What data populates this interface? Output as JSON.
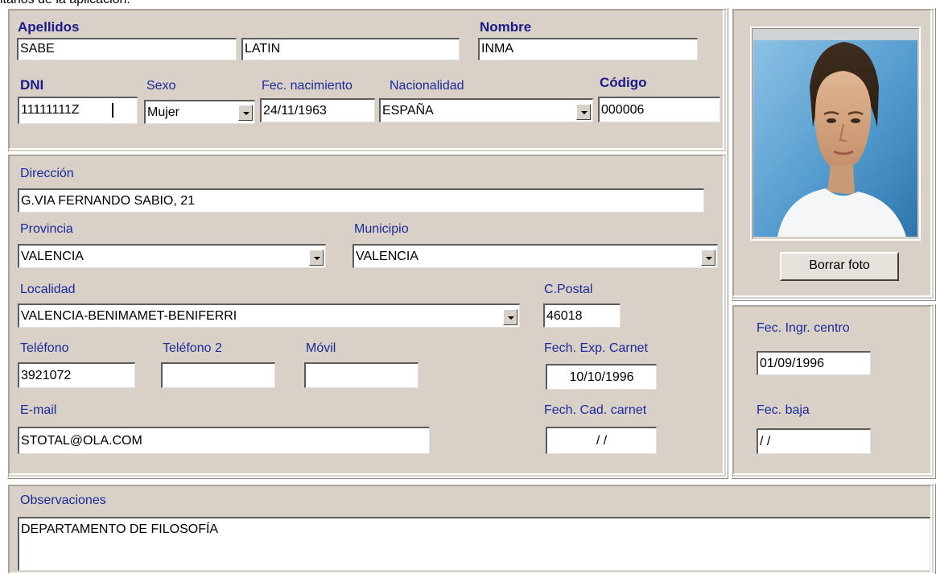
{
  "caption": "itarios de la aplicación.",
  "personal": {
    "apellidos_label": "Apellidos",
    "apellido1": "SABE",
    "apellido2": "LATIN",
    "nombre_label": "Nombre",
    "nombre": "INMA",
    "dni_label": "DNI",
    "dni": "11111111Z",
    "sexo_label": "Sexo",
    "sexo": "Mujer",
    "fec_nac_label": "Fec. nacimiento",
    "fec_nac": "24/11/1963",
    "nacionalidad_label": "Nacionalidad",
    "nacionalidad": "ESPAÑA",
    "codigo_label": "Código",
    "codigo": "000006"
  },
  "address": {
    "direccion_label": "Dirección",
    "direccion": "G.VIA FERNANDO SABIO, 21",
    "provincia_label": "Provincia",
    "provincia": "VALENCIA",
    "municipio_label": "Municipio",
    "municipio": "VALENCIA",
    "localidad_label": "Localidad",
    "localidad": "VALENCIA-BENIMAMET-BENIFERRI",
    "cpostal_label": "C.Postal",
    "cpostal": "46018",
    "telefono_label": "Teléfono",
    "telefono": "3921072",
    "telefono2_label": "Teléfono 2",
    "telefono2": "",
    "movil_label": "Móvil",
    "movil": "",
    "fech_exp_label": "Fech. Exp. Carnet",
    "fech_exp": "10/10/1996",
    "email_label": "E-mail",
    "email": "STOTAL@OLA.COM",
    "fech_cad_label": "Fech. Cad. carnet",
    "fech_cad": "/ /"
  },
  "photo": {
    "borrar_label": "Borrar foto"
  },
  "centro": {
    "fec_ingr_label": "Fec. Ingr. centro",
    "fec_ingr": "01/09/1996",
    "fec_baja_label": "Fec. baja",
    "fec_baja": "/ /"
  },
  "obs": {
    "label": "Observaciones",
    "value": "DEPARTAMENTO DE FILOSOFÍA"
  },
  "colors": {
    "panel": "#d9d1c8",
    "label_blue": "#1b2a9b"
  },
  "icons": {
    "dropdown": "chevron-down-icon"
  }
}
